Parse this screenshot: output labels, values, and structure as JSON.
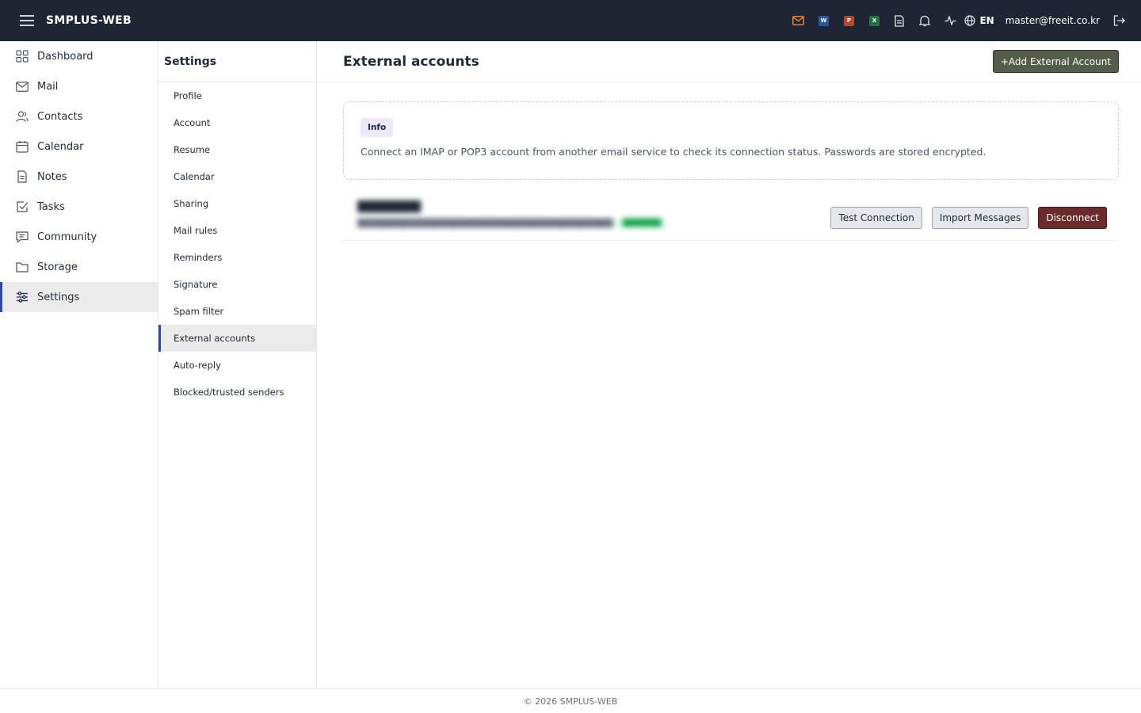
{
  "app": {
    "title": "SMPLUS-WEB"
  },
  "topbar": {
    "icons": [
      "mail-icon",
      "word-icon",
      "powerpoint-icon",
      "excel-icon",
      "document-icon",
      "bell-icon",
      "activity-icon",
      "globe-icon"
    ],
    "word_letter": "W",
    "powerpoint_letter": "P",
    "excel_letter": "X",
    "language": "EN",
    "user_email": "master@freeit.co.kr",
    "colors": {
      "bg": "#1e2533",
      "mail_accent": "#e8833a",
      "word": "#2b579a",
      "powerpoint": "#b7472a",
      "excel": "#217346"
    }
  },
  "sidebar": {
    "items": [
      {
        "label": "Dashboard",
        "icon": "grid-icon"
      },
      {
        "label": "Mail",
        "icon": "mail-icon"
      },
      {
        "label": "Contacts",
        "icon": "contacts-icon"
      },
      {
        "label": "Calendar",
        "icon": "calendar-icon"
      },
      {
        "label": "Notes",
        "icon": "note-icon"
      },
      {
        "label": "Tasks",
        "icon": "task-icon"
      },
      {
        "label": "Community",
        "icon": "chat-icon"
      },
      {
        "label": "Storage",
        "icon": "folder-icon"
      },
      {
        "label": "Settings",
        "icon": "sliders-icon",
        "active": true
      }
    ]
  },
  "settings_nav": {
    "title": "Settings",
    "items": [
      "Profile",
      "Account",
      "Resume",
      "Calendar",
      "Sharing",
      "Mail rules",
      "Reminders",
      "Signature",
      "Spam filter",
      "External accounts",
      "Auto-reply",
      "Blocked/trusted senders"
    ],
    "active": "External accounts"
  },
  "main": {
    "title": "External accounts",
    "add_button": "+Add External Account",
    "info": {
      "badge": "Info",
      "text": "Connect an IMAP or POP3 account from another email service to check its connection status. Passwords are stored encrypted."
    },
    "accounts": [
      {
        "actions": {
          "test": "Test Connection",
          "import": "Import Messages",
          "disconnect": "Disconnect"
        }
      }
    ]
  },
  "footer": {
    "text": "© 2026 SMPLUS-WEB"
  },
  "colors": {
    "accent": "#2d4aa8",
    "add_button": "#545c4a",
    "danger": "#6b2b2b"
  }
}
